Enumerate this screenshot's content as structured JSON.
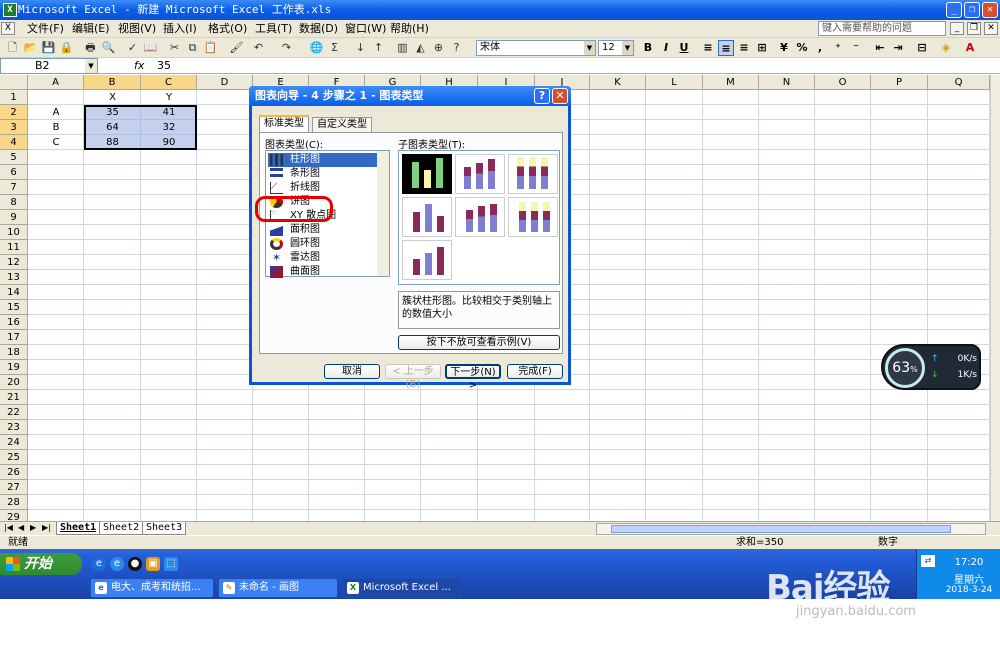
{
  "window": {
    "title": "Microsoft Excel - 新建 Microsoft Excel 工作表.xls"
  },
  "menu": {
    "items": [
      "文件(F)",
      "编辑(E)",
      "视图(V)",
      "插入(I)",
      "格式(O)",
      "工具(T)",
      "数据(D)",
      "窗口(W)",
      "帮助(H)"
    ],
    "help_placeholder": "键入需要帮助的问题"
  },
  "toolbar": {
    "font": "宋体",
    "size": "12"
  },
  "formula_bar": {
    "name_box": "B2",
    "fx": "fx",
    "value": "35"
  },
  "grid": {
    "columns": [
      "A",
      "B",
      "C",
      "D",
      "E",
      "F",
      "G",
      "H",
      "I",
      "J",
      "K",
      "L",
      "M",
      "N",
      "O",
      "P",
      "Q"
    ],
    "rows": [
      "1",
      "2",
      "3",
      "4",
      "5",
      "6",
      "7",
      "8",
      "9",
      "10",
      "11",
      "12",
      "13",
      "14",
      "15",
      "16",
      "17",
      "18",
      "19",
      "20",
      "21",
      "22",
      "23",
      "24",
      "25",
      "26",
      "27",
      "28",
      "29"
    ],
    "cells": {
      "B1": "X",
      "C1": "Y",
      "A2": "A",
      "B2": "35",
      "C2": "41",
      "A3": "B",
      "B3": "64",
      "C3": "32",
      "A4": "C",
      "B4": "88",
      "C4": "90"
    }
  },
  "sheets": [
    "Sheet1",
    "Sheet2",
    "Sheet3"
  ],
  "status": {
    "left": "就绪",
    "sum": "求和=350",
    "mode": "数字"
  },
  "dialog": {
    "title": "图表向导 - 4 步骤之 1 - 图表类型",
    "tabs": [
      "标准类型",
      "自定义类型"
    ],
    "chart_type_label": "图表类型(C):",
    "subtype_label": "子图表类型(T):",
    "chart_types": [
      "柱形图",
      "条形图",
      "折线图",
      "饼图",
      "XY 散点图",
      "面积图",
      "圆环图",
      "雷达图",
      "曲面图"
    ],
    "description": "簇状柱形图。比较相交于类别轴上的数值大小",
    "preview_button": "按下不放可查看示例(V)",
    "buttons": {
      "cancel": "取消",
      "back": "< 上一步(B)",
      "next": "下一步(N) >",
      "finish": "完成(F)"
    }
  },
  "taskbar": {
    "start": "开始",
    "tasks": [
      "电大、成考和统招...",
      "未命名 - 画图",
      "Microsoft Excel ..."
    ],
    "time": "17:20",
    "weekday": "星期六",
    "date": "2018-3-24"
  },
  "net_widget": {
    "percent": "63",
    "unit": "%",
    "up": "0K/s",
    "down": "1K/s"
  },
  "watermark": {
    "brand": "Bai经验",
    "url": "jingyan.baidu.com"
  }
}
